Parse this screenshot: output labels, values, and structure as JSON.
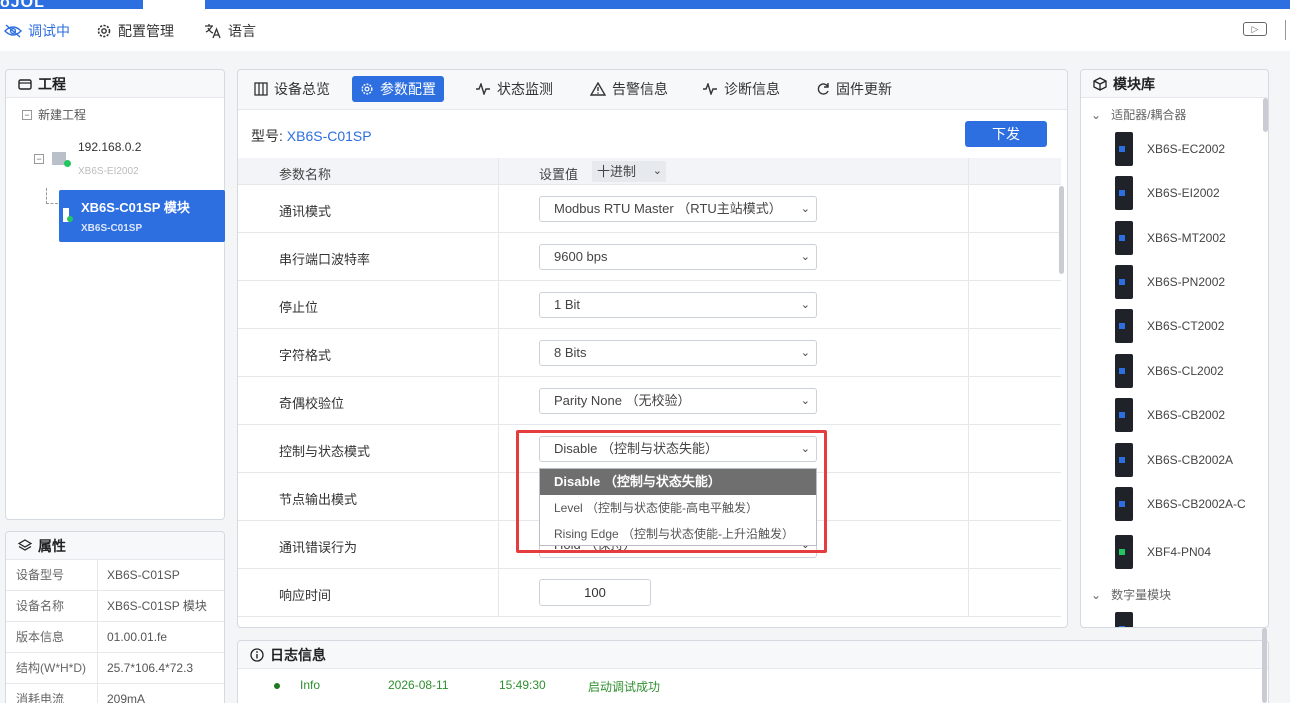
{
  "topbar": {
    "logo": "oJOL"
  },
  "toolbar": {
    "debug_label": "调试中",
    "config_label": "配置管理",
    "lang_label": "语言"
  },
  "project": {
    "title": "工程",
    "root": "新建工程",
    "ip": "192.168.0.2",
    "ip_sub": "XB6S-EI2002",
    "selected_title": "XB6S-C01SP 模块",
    "selected_sub": "XB6S-C01SP"
  },
  "props": {
    "title": "属性",
    "rows": [
      {
        "k": "设备型号",
        "v": "XB6S-C01SP"
      },
      {
        "k": "设备名称",
        "v": "XB6S-C01SP 模块"
      },
      {
        "k": "版本信息",
        "v": "01.00.01.fe"
      },
      {
        "k": "结构(W*H*D)",
        "v": "25.7*106.4*72.3"
      },
      {
        "k": "消耗电流",
        "v": "209mA"
      }
    ]
  },
  "main": {
    "tabs": [
      "设备总览",
      "参数配置",
      "状态监测",
      "告警信息",
      "诊断信息",
      "固件更新"
    ],
    "model_label": "型号:",
    "model_value": "XB6S-C01SP",
    "send_label": "下发",
    "col_name": "参数名称",
    "col_value": "设置值",
    "radix": "十进制",
    "rows": [
      {
        "name": "通讯模式",
        "value": "Modbus RTU Master （RTU主站模式）"
      },
      {
        "name": "串行端口波特率",
        "value": "9600 bps"
      },
      {
        "name": "停止位",
        "value": "1 Bit"
      },
      {
        "name": "字符格式",
        "value": "8 Bits"
      },
      {
        "name": "奇偶校验位",
        "value": "Parity None （无校验）"
      },
      {
        "name": "控制与状态模式",
        "value": "Disable （控制与状态失能）"
      },
      {
        "name": "节点输出模式",
        "value": ""
      },
      {
        "name": "通讯错误行为",
        "value": "Hold （保持）"
      },
      {
        "name": "响应时间",
        "value": "100"
      }
    ],
    "dropdown": [
      "Disable （控制与状态失能）",
      "Level （控制与状态使能-高电平触发）",
      "Rising Edge （控制与状态使能-上升沿触发）"
    ]
  },
  "lib": {
    "title": "模块库",
    "group1": "适配器/耦合器",
    "items": [
      "XB6S-EC2002",
      "XB6S-EI2002",
      "XB6S-MT2002",
      "XB6S-PN2002",
      "XB6S-CT2002",
      "XB6S-CL2002",
      "XB6S-CB2002",
      "XB6S-CB2002A",
      "XB6S-CB2002A-C",
      "XBF4-PN04"
    ],
    "group2": "数字量模块"
  },
  "log": {
    "title": "日志信息",
    "level": "Info",
    "date": "2026-08-11",
    "time": "15:49:30",
    "msg": "启动调试成功"
  },
  "colors": {
    "accent": "#2d6ee0",
    "highlight": "#e53d3d",
    "ok": "#22c55e"
  }
}
